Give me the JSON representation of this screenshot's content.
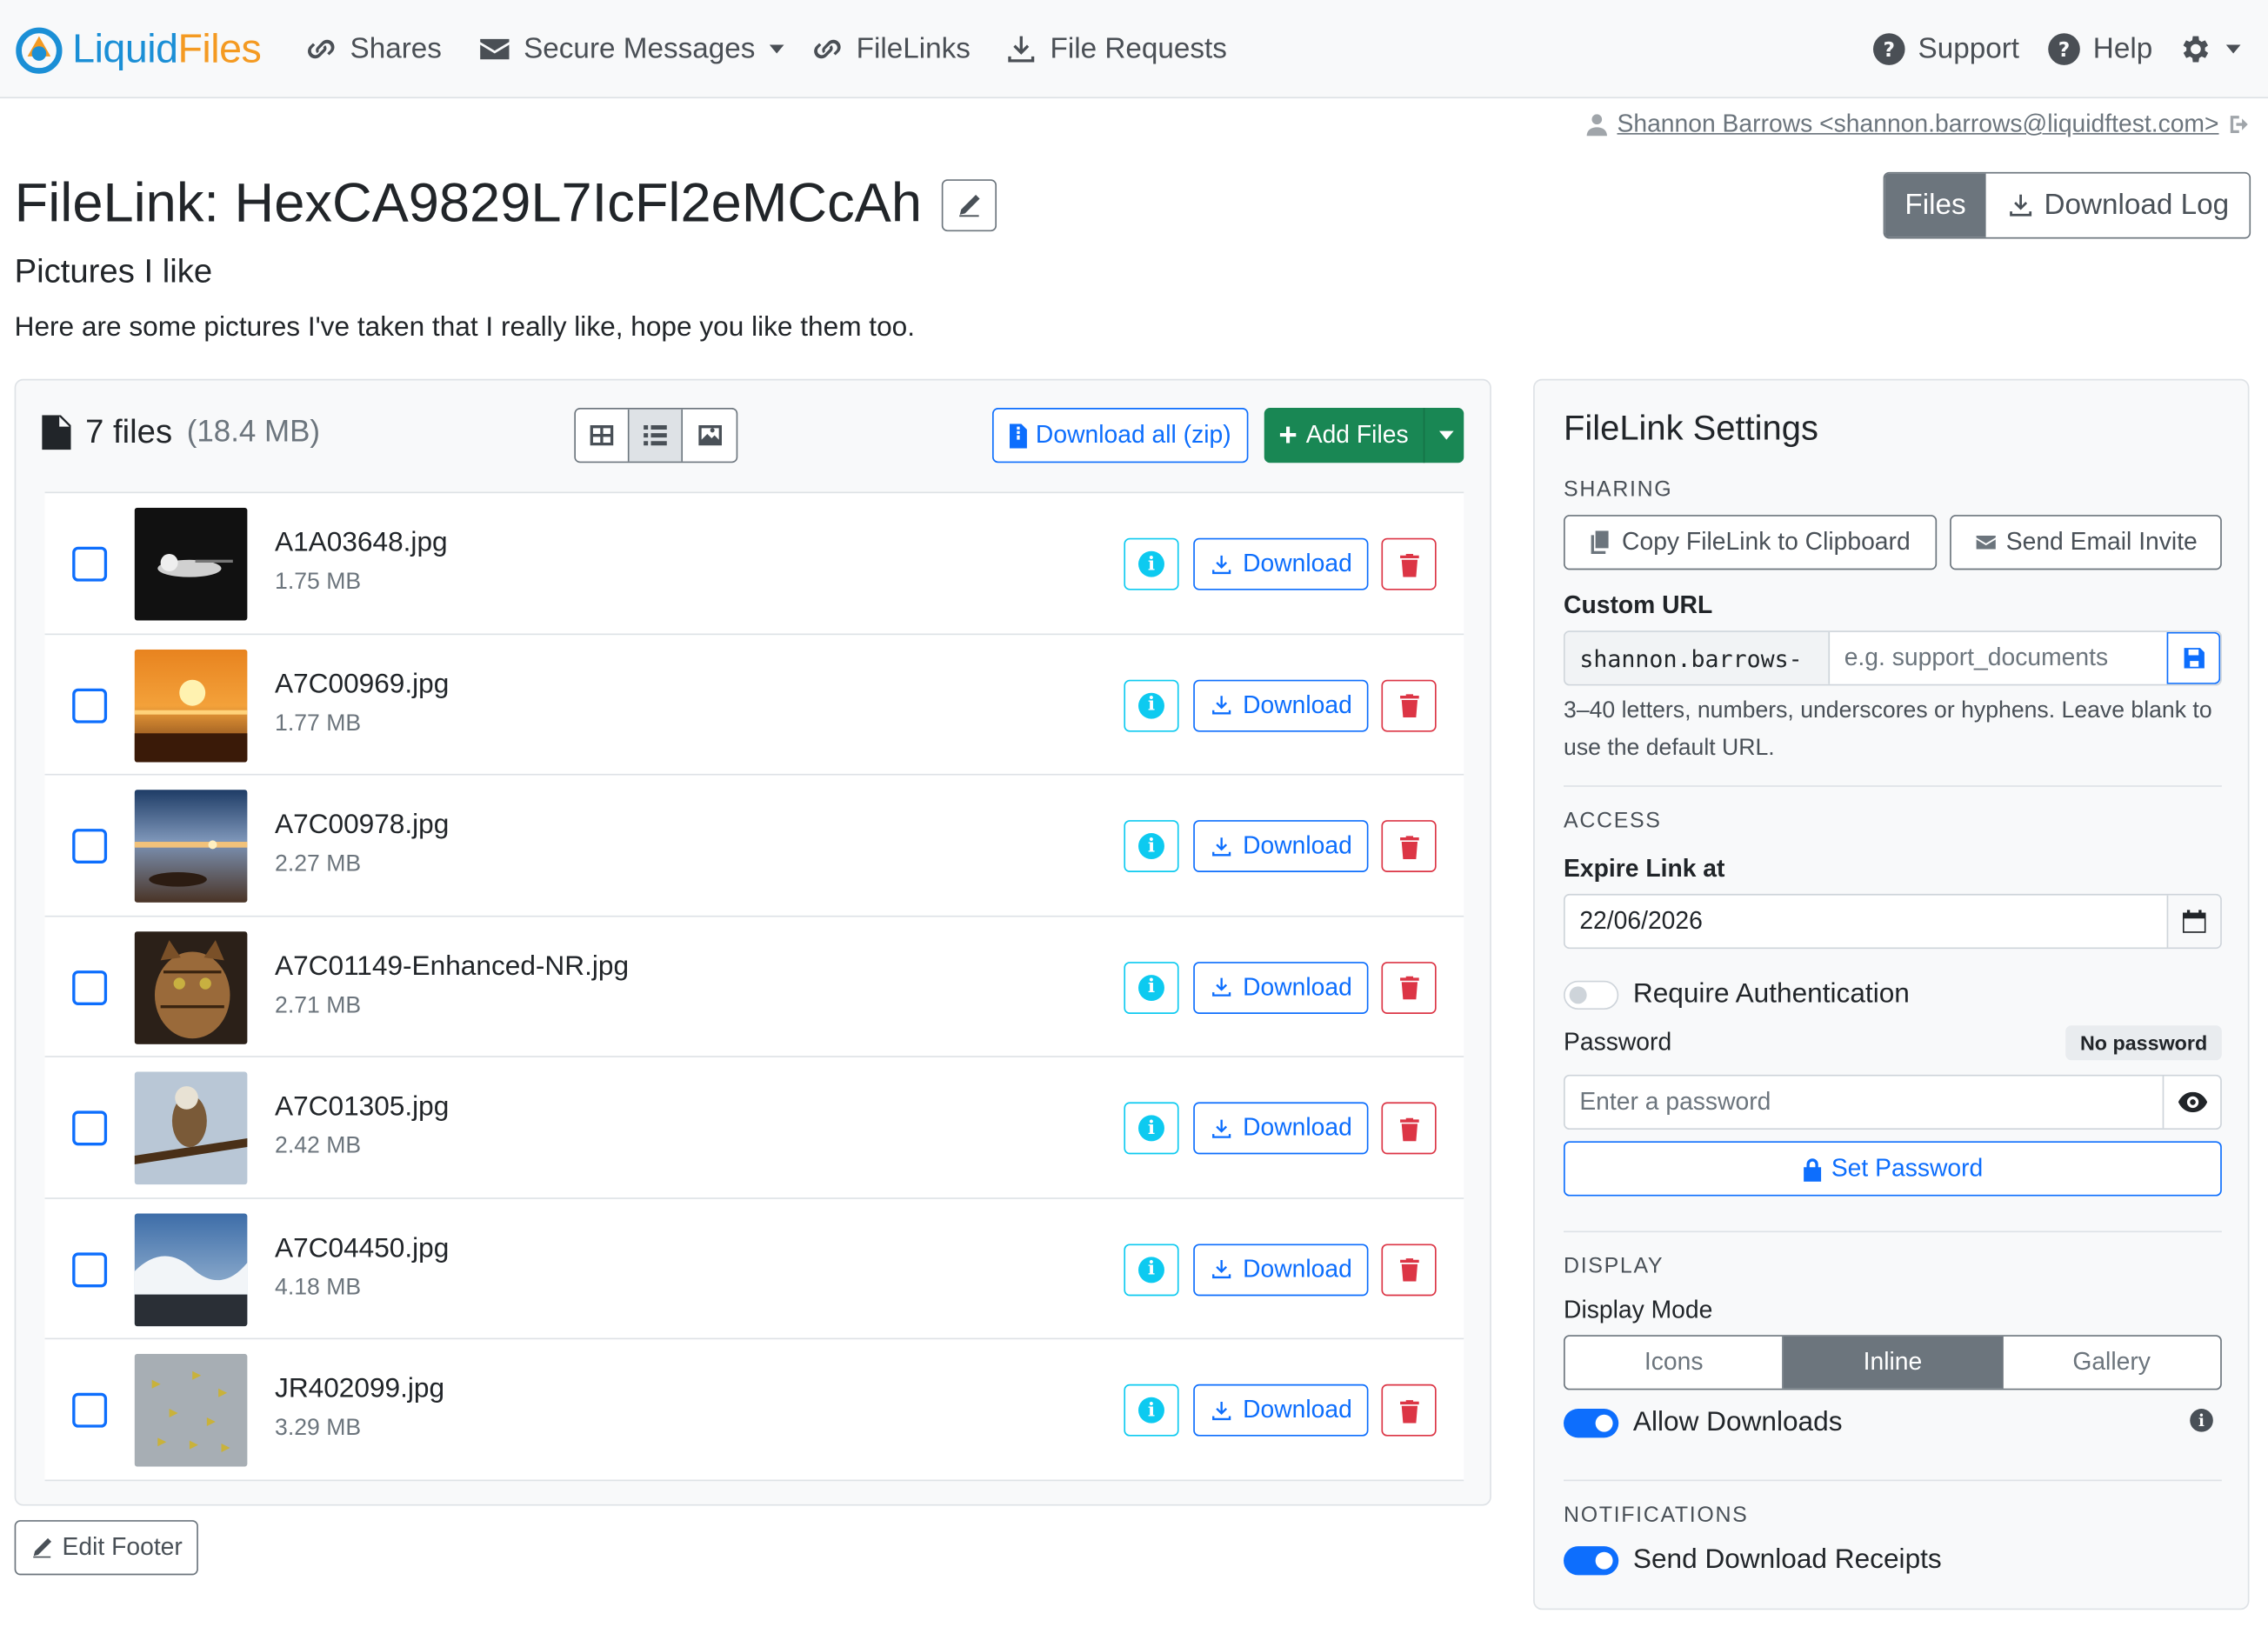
{
  "nav": {
    "brand_main": "Liquid",
    "brand_accent": "Files",
    "items": [
      {
        "label": "Shares",
        "icon": "link-icon"
      },
      {
        "label": "Secure Messages",
        "icon": "envelope-icon",
        "dropdown": true
      },
      {
        "label": "FileLinks",
        "icon": "link-icon"
      },
      {
        "label": "File Requests",
        "icon": "download-icon"
      }
    ],
    "support": "Support",
    "help": "Help"
  },
  "user": {
    "display": "Shannon Barrows <shannon.barrows@liquidftest.com>"
  },
  "page": {
    "title": "FileLink: HexCA9829L7IcFl2eMCcAh",
    "subtitle": "Pictures I like",
    "description": "Here are some pictures I've taken that I really like, hope you like them too."
  },
  "tabs": {
    "files": "Files",
    "download_log": "Download Log"
  },
  "files_panel": {
    "count_label": "7 files",
    "total_size": "(18.4 MB)",
    "download_all": "Download all (zip)",
    "add_files": "Add Files",
    "download_label": "Download",
    "files": [
      {
        "name": "A1A03648.jpg",
        "size": "1.75 MB"
      },
      {
        "name": "A7C00969.jpg",
        "size": "1.77 MB"
      },
      {
        "name": "A7C00978.jpg",
        "size": "2.27 MB"
      },
      {
        "name": "A7C01149-Enhanced-NR.jpg",
        "size": "2.71 MB"
      },
      {
        "name": "A7C01305.jpg",
        "size": "2.42 MB"
      },
      {
        "name": "A7C04450.jpg",
        "size": "4.18 MB"
      },
      {
        "name": "JR402099.jpg",
        "size": "3.29 MB"
      }
    ]
  },
  "edit_footer": "Edit Footer",
  "settings": {
    "title": "FileLink Settings",
    "sharing_heading": "SHARING",
    "copy_link": "Copy FileLink to Clipboard",
    "send_invite": "Send Email Invite",
    "custom_url_label": "Custom URL",
    "custom_url_prefix": "shannon.barrows-",
    "custom_url_placeholder": "e.g. support_documents",
    "custom_url_help": "3–40 letters, numbers, underscores or hyphens. Leave blank to use the default URL.",
    "access_heading": "ACCESS",
    "expire_label": "Expire Link at",
    "expire_value": "22/06/2026",
    "require_auth": "Require Authentication",
    "require_auth_on": false,
    "password_label": "Password",
    "password_badge": "No password",
    "password_placeholder": "Enter a password",
    "set_password": "Set Password",
    "display_heading": "DISPLAY",
    "display_mode_label": "Display Mode",
    "modes": [
      "Icons",
      "Inline",
      "Gallery"
    ],
    "active_mode": "Inline",
    "allow_downloads": "Allow Downloads",
    "allow_downloads_on": true,
    "notifications_heading": "NOTIFICATIONS",
    "send_receipts": "Send Download Receipts",
    "send_receipts_on": true
  },
  "colors": {
    "primary": "#0d6efd",
    "success": "#198754",
    "danger": "#dc3545",
    "info": "#0dcaf0",
    "secondary": "#6c757d",
    "brand_blue": "#1b8fd6",
    "brand_orange": "#f49a22"
  }
}
